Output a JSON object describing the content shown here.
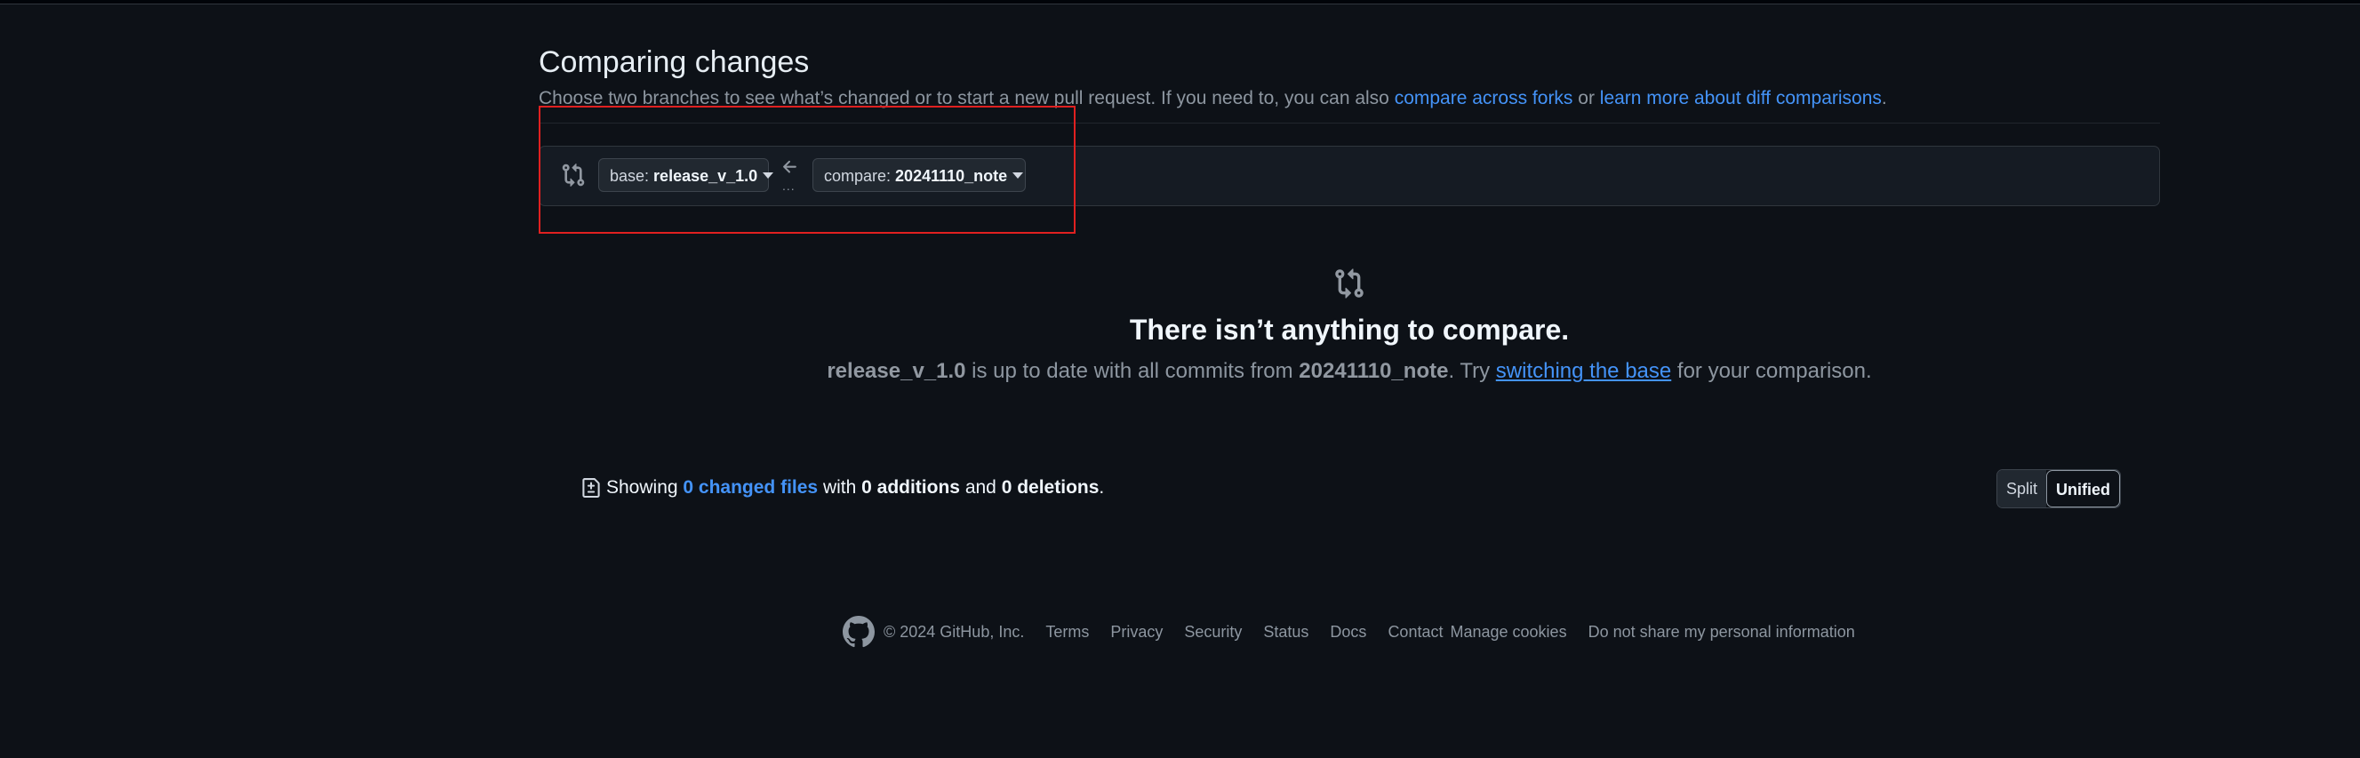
{
  "header": {
    "title": "Comparing changes",
    "subtitle_prefix": "Choose two branches to see what’s changed or to start a new pull request. If you need to, you can also ",
    "link_forks": "compare across forks",
    "subtitle_or": " or ",
    "link_learn": "learn more about diff comparisons",
    "subtitle_end": "."
  },
  "range": {
    "base_prefix": "base: ",
    "base_branch": "release_v_1.0",
    "compare_prefix": "compare: ",
    "compare_branch": "20241110_note",
    "dots": "..."
  },
  "blank": {
    "title": "There isn’t anything to compare.",
    "base_branch": "release_v_1.0",
    "desc_mid": " is up to date with all commits from ",
    "compare_branch": "20241110_note",
    "desc_try": ". Try ",
    "link_switch": "switching the base",
    "desc_end": " for your comparison."
  },
  "summary": {
    "showing": "Showing ",
    "changed_files": "0 changed files",
    "with": " with ",
    "additions": "0 additions",
    "and": " and ",
    "deletions": "0 deletions",
    "end": "."
  },
  "view_toggle": {
    "split": "Split",
    "unified": "Unified",
    "active": "Unified"
  },
  "footer": {
    "copyright": "© 2024 GitHub, Inc.",
    "links": [
      "Terms",
      "Privacy",
      "Security",
      "Status",
      "Docs",
      "Contact",
      "Manage cookies",
      "Do not share my personal information"
    ]
  },
  "colors": {
    "background": "#0d1117",
    "link": "#4493f8",
    "highlight": "#e02020"
  }
}
